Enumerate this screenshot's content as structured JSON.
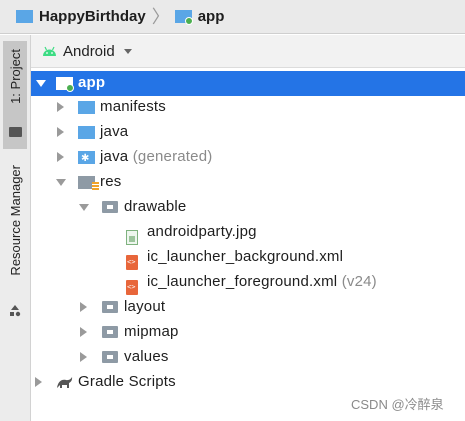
{
  "breadcrumb": {
    "project": "HappyBirthday",
    "module": "app"
  },
  "sidebar": {
    "project_tab": "1: Project",
    "resource_manager_tab": "Resource Manager"
  },
  "panel": {
    "view_mode": "Android"
  },
  "tree": {
    "app": "app",
    "manifests": "manifests",
    "java": "java",
    "java_generated": "java",
    "java_generated_suffix": "(generated)",
    "res": "res",
    "drawable": "drawable",
    "androidparty": "androidparty.jpg",
    "ic_launcher_background": "ic_launcher_background.xml",
    "ic_launcher_foreground": "ic_launcher_foreground.xml",
    "ic_launcher_foreground_suffix": "(v24)",
    "layout": "layout",
    "mipmap": "mipmap",
    "values": "values",
    "gradle_scripts": "Gradle Scripts"
  },
  "watermark": "CSDN @冷醉泉",
  "colors": {
    "selection": "#2474e6",
    "android_green": "#3ddc84",
    "folder_blue": "#5aa6e6"
  }
}
